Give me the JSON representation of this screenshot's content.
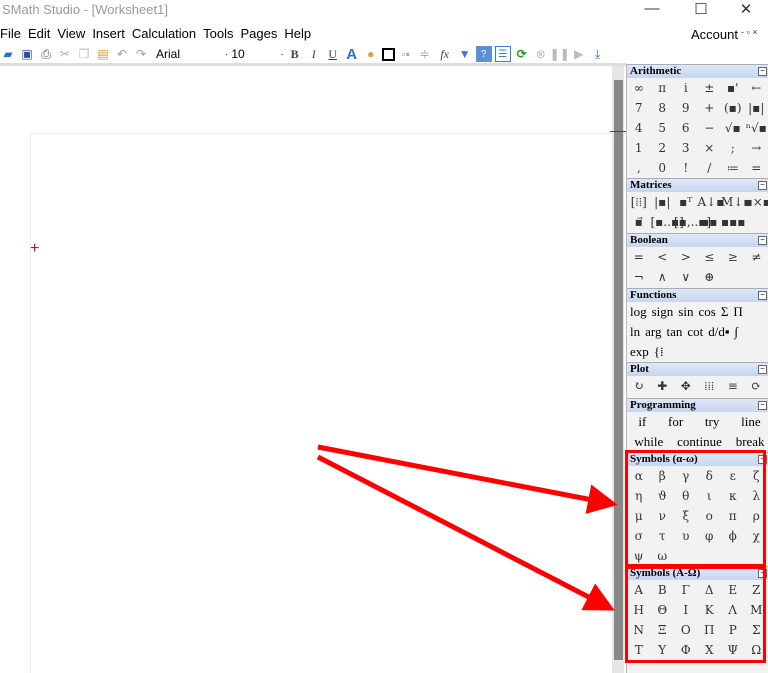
{
  "window": {
    "title": "SMath Studio - [Worksheet1]",
    "minimize": "—",
    "maximize": "☐",
    "close": "✕"
  },
  "menu": [
    "File",
    "Edit",
    "View",
    "Insert",
    "Calculation",
    "Tools",
    "Pages",
    "Help"
  ],
  "account": {
    "label": "Account",
    "controls": "- ▫ ×"
  },
  "toolbar": {
    "font": "Arial",
    "size": "10",
    "bold": "B",
    "italic": "I",
    "underline": "U",
    "fx": "fx",
    "icons": [
      "open-icon",
      "save-icon",
      "print-icon",
      "cut-icon",
      "copy-icon",
      "paste-icon",
      "undo-icon",
      "redo-icon"
    ],
    "icons2": [
      "text-color-icon",
      "palette-icon",
      "border-icon",
      "align-horizontal-icon",
      "align-vertical-icon"
    ],
    "icons3": [
      "filter-icon",
      "help-icon",
      "sidebar-icon",
      "recalculate-icon",
      "stop-icon",
      "pause-icon",
      "play-icon",
      "step-icon"
    ]
  },
  "worksheet": {
    "cursor": "+"
  },
  "panel": {
    "arithmetic": {
      "title": "Arithmetic",
      "rows": [
        [
          "∞",
          "π",
          "i",
          "±",
          "▪'",
          "←"
        ],
        [
          "7",
          "8",
          "9",
          "+",
          "(▪)",
          "|▪|"
        ],
        [
          "4",
          "5",
          "6",
          "−",
          "√▪",
          "ⁿ√▪"
        ],
        [
          "1",
          "2",
          "3",
          "×",
          ";",
          "→"
        ],
        [
          ",",
          "0",
          "!",
          "/",
          "≔",
          "="
        ]
      ]
    },
    "matrices": {
      "title": "Matrices",
      "rows": [
        [
          "[⁞⁞]",
          "|▪|",
          "▪ᵀ",
          "A↓▪",
          "M↓▪",
          "▪×▪"
        ],
        [
          "▪⃗",
          "[▪..▪]",
          "[▪,..▪]",
          "▪▪",
          "▪▪▪"
        ]
      ]
    },
    "boolean": {
      "title": "Boolean",
      "rows": [
        [
          "=",
          "<",
          ">",
          "≤",
          "≥",
          "≠"
        ],
        [
          "¬",
          "∧",
          "∨",
          "⊕"
        ]
      ]
    },
    "functions": {
      "title": "Functions",
      "rows": [
        [
          "log",
          "sign",
          "sin",
          "cos",
          "Σ",
          "Π"
        ],
        [
          "ln",
          "arg",
          "tan",
          "cot",
          "d/d▪",
          "∫"
        ],
        [
          "exp",
          "{⁞"
        ]
      ]
    },
    "plot": {
      "title": "Plot",
      "rows": [
        [
          "↻",
          "✚",
          "✥",
          "⁞⁞⁞",
          "≡",
          "⟳"
        ]
      ]
    },
    "programming": {
      "title": "Programming",
      "rows": [
        [
          "if",
          "for",
          "try",
          "line"
        ],
        [
          "while",
          "continue",
          "break"
        ]
      ]
    },
    "symbols_lower": {
      "title": "Symbols (α-ω)",
      "rows": [
        [
          "α",
          "β",
          "γ",
          "δ",
          "ε",
          "ζ"
        ],
        [
          "η",
          "ϑ",
          "θ",
          "ι",
          "κ",
          "λ"
        ],
        [
          "μ",
          "ν",
          "ξ",
          "ο",
          "π",
          "ρ"
        ],
        [
          "σ",
          "τ",
          "υ",
          "φ",
          "ϕ",
          "χ"
        ],
        [
          "ψ",
          "ω"
        ]
      ]
    },
    "symbols_upper": {
      "title": "Symbols (A-Ω)",
      "rows": [
        [
          "Α",
          "Β",
          "Γ",
          "Δ",
          "Ε",
          "Ζ"
        ],
        [
          "Η",
          "Θ",
          "Ι",
          "Κ",
          "Λ",
          "Μ"
        ],
        [
          "Ν",
          "Ξ",
          "Ο",
          "Π",
          "Ρ",
          "Σ"
        ],
        [
          "Τ",
          "Υ",
          "Φ",
          "Χ",
          "Ψ",
          "Ω"
        ]
      ]
    }
  },
  "annotation_color": "#ff0000"
}
